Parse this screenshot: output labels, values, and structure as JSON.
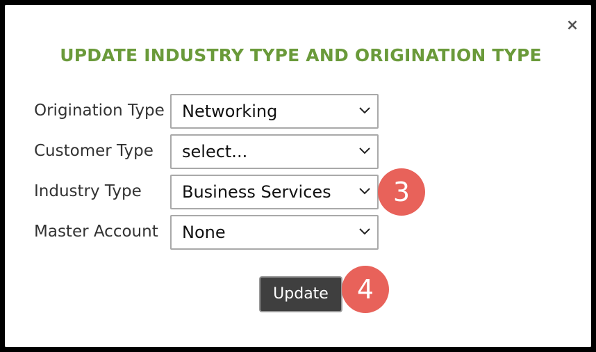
{
  "dialog": {
    "title": "UPDATE INDUSTRY TYPE AND ORIGINATION TYPE",
    "close_glyph": "×"
  },
  "fields": [
    {
      "label": "Origination Type",
      "selected": "Networking"
    },
    {
      "label": "Customer Type",
      "selected": "select..."
    },
    {
      "label": "Industry Type",
      "selected": "Business Services"
    },
    {
      "label": "Master Account",
      "selected": "None"
    }
  ],
  "actions": {
    "update_label": "Update"
  },
  "badges": {
    "step_industry": "3",
    "step_update": "4"
  },
  "colors": {
    "title": "#6a9a3a",
    "badge": "#e8625a",
    "button": "#3f3f3f"
  }
}
